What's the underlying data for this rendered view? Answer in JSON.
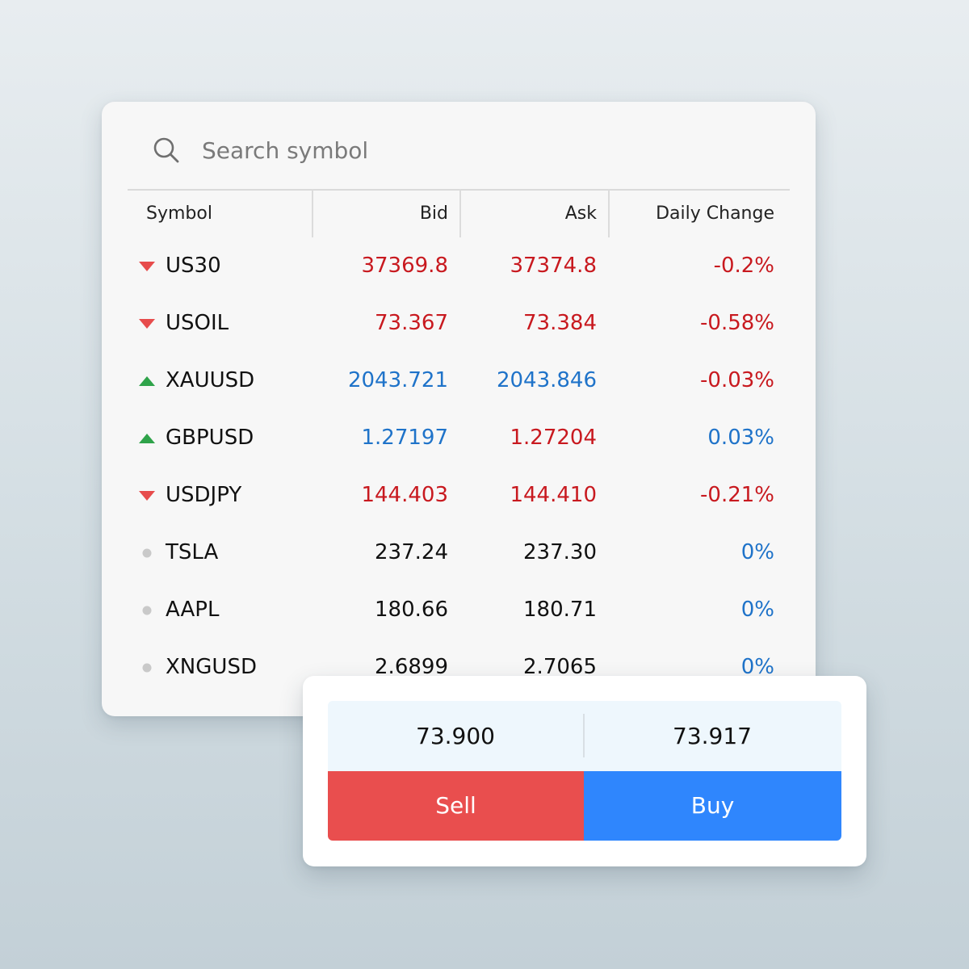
{
  "search": {
    "placeholder": "Search symbol",
    "icon": "search-icon"
  },
  "columns": {
    "symbol": "Symbol",
    "bid": "Bid",
    "ask": "Ask",
    "change": "Daily Change"
  },
  "colors": {
    "down": "#c8191f",
    "up": "#1f73c9",
    "neutral": "#111111",
    "indicator_down": "#e74c4c",
    "indicator_up": "#2fa34a",
    "indicator_neutral": "#c9c9c9",
    "sell": "#e94e4e",
    "buy": "#2f86fd"
  },
  "rows": [
    {
      "indicator": "down",
      "symbol": "US30",
      "bid": "37369.8",
      "bid_dir": "down",
      "ask": "37374.8",
      "ask_dir": "down",
      "change": "-0.2%",
      "change_dir": "down"
    },
    {
      "indicator": "down",
      "symbol": "USOIL",
      "bid": "73.367",
      "bid_dir": "down",
      "ask": "73.384",
      "ask_dir": "down",
      "change": "-0.58%",
      "change_dir": "down"
    },
    {
      "indicator": "up",
      "symbol": "XAUUSD",
      "bid": "2043.721",
      "bid_dir": "up",
      "ask": "2043.846",
      "ask_dir": "up",
      "change": "-0.03%",
      "change_dir": "down"
    },
    {
      "indicator": "up",
      "symbol": "GBPUSD",
      "bid": "1.27197",
      "bid_dir": "up",
      "ask": "1.27204",
      "ask_dir": "down",
      "change": "0.03%",
      "change_dir": "up"
    },
    {
      "indicator": "down",
      "symbol": "USDJPY",
      "bid": "144.403",
      "bid_dir": "down",
      "ask": "144.410",
      "ask_dir": "down",
      "change": "-0.21%",
      "change_dir": "down"
    },
    {
      "indicator": "neutral",
      "symbol": "TSLA",
      "bid": "237.24",
      "bid_dir": "neutral",
      "ask": "237.30",
      "ask_dir": "neutral",
      "change": "0%",
      "change_dir": "up"
    },
    {
      "indicator": "neutral",
      "symbol": "AAPL",
      "bid": "180.66",
      "bid_dir": "neutral",
      "ask": "180.71",
      "ask_dir": "neutral",
      "change": "0%",
      "change_dir": "up"
    },
    {
      "indicator": "neutral",
      "symbol": "XNGUSD",
      "bid": "2.6899",
      "bid_dir": "neutral",
      "ask": "2.7065",
      "ask_dir": "neutral",
      "change": "0%",
      "change_dir": "up"
    }
  ],
  "trade": {
    "sell_price": "73.900",
    "buy_price": "73.917",
    "sell_label": "Sell",
    "buy_label": "Buy"
  }
}
